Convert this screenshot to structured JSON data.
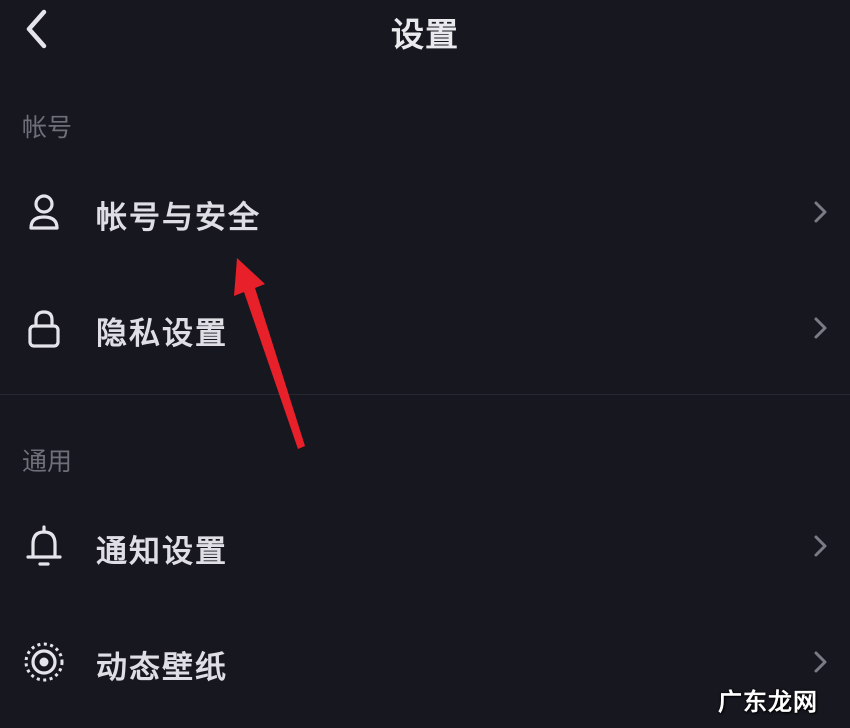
{
  "header": {
    "title": "设置"
  },
  "sections": [
    {
      "title": "帐号",
      "items": [
        {
          "label": "帐号与安全",
          "icon": "user-icon"
        },
        {
          "label": "隐私设置",
          "icon": "lock-icon"
        }
      ]
    },
    {
      "title": "通用",
      "items": [
        {
          "label": "通知设置",
          "icon": "bell-icon"
        },
        {
          "label": "动态壁纸",
          "icon": "wallpaper-icon"
        }
      ]
    }
  ],
  "watermark": "广东龙网",
  "colors": {
    "background": "#171720",
    "text": "#dedee4",
    "section_label": "#6f6f7a",
    "annotation_arrow": "#e8202a"
  }
}
